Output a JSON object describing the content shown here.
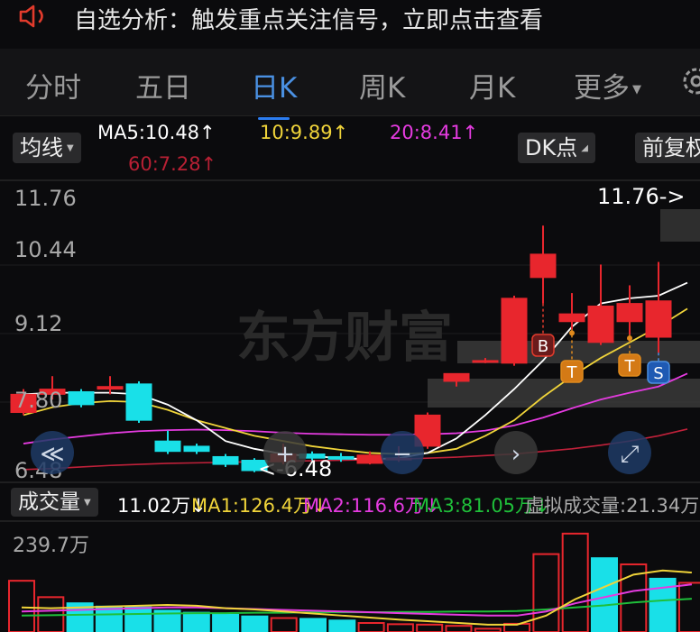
{
  "banner": {
    "text": "自选分析：触发重点关注信号，立即点击查看"
  },
  "tabs": [
    {
      "label": "分时",
      "active": false
    },
    {
      "label": "五日",
      "active": false
    },
    {
      "label": "日K",
      "active": true
    },
    {
      "label": "周K",
      "active": false
    },
    {
      "label": "月K",
      "active": false
    },
    {
      "label": "更多",
      "active": false
    }
  ],
  "ma_bar": {
    "indicator": "均线",
    "ma5": "MA5:10.48↑",
    "ma10": "10:9.89↑",
    "ma20": "20:8.41↑",
    "ma60": "60:7.28↑",
    "dk_button": "DK点",
    "adjust_button": "前复权"
  },
  "price_axis": {
    "labels": [
      "11.76",
      "10.44",
      "9.12",
      "7.80",
      "6.48"
    ]
  },
  "markers": {
    "high": "11.76->",
    "low": "<-6.48"
  },
  "signals": [
    "B",
    "T",
    "T",
    "S"
  ],
  "watermark": "东方财富",
  "volume_bar": {
    "indicator": "成交量",
    "volume": "11.02万↓",
    "ma1": "MA1:126.4万↓",
    "ma2": "MA2:116.6万↓",
    "ma3": "MA3:81.05万↓",
    "virtual": "虚拟成交量:21.34万",
    "axis_max": "239.7万"
  },
  "colors": {
    "up": "#e8262d",
    "down": "#19e0e8",
    "ma5": "#ffffff",
    "ma10": "#f0d43a",
    "ma20": "#e53be0",
    "ma60": "#c0213a",
    "accent": "#2b7cf0"
  },
  "chart_data": {
    "type": "candlestick",
    "ylim": [
      6.48,
      11.76
    ],
    "candles": [
      {
        "o": 7.6,
        "c": 7.95,
        "h": 8.05,
        "l": 7.55
      },
      {
        "o": 7.95,
        "c": 8.05,
        "h": 8.3,
        "l": 7.85
      },
      {
        "o": 8.0,
        "c": 7.75,
        "h": 8.05,
        "l": 7.7
      },
      {
        "o": 8.05,
        "c": 8.1,
        "h": 8.3,
        "l": 7.95
      },
      {
        "o": 8.15,
        "c": 7.45,
        "h": 8.2,
        "l": 7.4
      },
      {
        "o": 7.05,
        "c": 6.85,
        "h": 7.25,
        "l": 6.8
      },
      {
        "o": 6.95,
        "c": 6.85,
        "h": 7.0,
        "l": 6.8
      },
      {
        "o": 6.75,
        "c": 6.6,
        "h": 6.8,
        "l": 6.55
      },
      {
        "o": 6.68,
        "c": 6.48,
        "h": 6.72,
        "l": 6.45
      },
      {
        "o": 6.65,
        "c": 6.8,
        "h": 7.0,
        "l": 6.6
      },
      {
        "o": 6.8,
        "c": 6.72,
        "h": 6.85,
        "l": 6.68
      },
      {
        "o": 6.75,
        "c": 6.7,
        "h": 6.82,
        "l": 6.65
      },
      {
        "o": 6.62,
        "c": 6.78,
        "h": 6.85,
        "l": 6.6
      },
      {
        "o": 6.72,
        "c": 6.72,
        "h": 6.95,
        "l": 6.65
      },
      {
        "o": 6.95,
        "c": 7.55,
        "h": 7.6,
        "l": 6.9
      },
      {
        "o": 8.2,
        "c": 8.35,
        "h": 8.35,
        "l": 8.1
      },
      {
        "o": 8.6,
        "c": 8.6,
        "h": 8.65,
        "l": 8.55
      },
      {
        "o": 8.55,
        "c": 9.8,
        "h": 9.85,
        "l": 8.5
      },
      {
        "o": 10.2,
        "c": 10.65,
        "h": 11.2,
        "l": 9.7
      },
      {
        "o": 9.35,
        "c": 9.5,
        "h": 9.9,
        "l": 9.2
      },
      {
        "o": 8.95,
        "c": 9.65,
        "h": 10.45,
        "l": 8.9
      },
      {
        "o": 9.35,
        "c": 9.7,
        "h": 10.05,
        "l": 9.1
      },
      {
        "o": 9.05,
        "c": 9.75,
        "h": 10.5,
        "l": 8.75
      }
    ],
    "ma5": [
      7.95,
      7.98,
      7.98,
      7.98,
      7.95,
      7.75,
      7.45,
      7.05,
      6.9,
      6.8,
      6.76,
      6.72,
      6.7,
      6.72,
      6.82,
      7.1,
      7.55,
      8.05,
      8.6,
      9.25,
      9.7,
      9.8,
      9.85,
      10.1
    ],
    "ma10": [
      7.55,
      7.7,
      7.78,
      7.82,
      7.8,
      7.65,
      7.45,
      7.3,
      7.15,
      7.05,
      6.95,
      6.88,
      6.82,
      6.8,
      6.82,
      6.9,
      7.15,
      7.45,
      7.9,
      8.3,
      8.65,
      8.95,
      9.25,
      9.6
    ],
    "ma20": [
      7.0,
      7.08,
      7.14,
      7.2,
      7.24,
      7.26,
      7.27,
      7.26,
      7.24,
      7.21,
      7.19,
      7.18,
      7.17,
      7.17,
      7.18,
      7.2,
      7.25,
      7.35,
      7.5,
      7.68,
      7.85,
      7.98,
      8.1,
      8.35
    ],
    "ma60": [
      6.5,
      6.52,
      6.55,
      6.58,
      6.6,
      6.62,
      6.63,
      6.64,
      6.65,
      6.66,
      6.67,
      6.68,
      6.69,
      6.7,
      6.72,
      6.74,
      6.77,
      6.8,
      6.85,
      6.9,
      6.97,
      7.05,
      7.15,
      7.28
    ],
    "volume": {
      "ymax": 239.7,
      "bars": [
        125,
        85,
        70,
        62,
        60,
        52,
        47,
        42,
        38,
        34,
        32,
        28,
        22,
        19,
        18,
        15,
        8,
        20,
        190,
        240,
        180,
        165,
        130,
        120
      ],
      "up": [
        true,
        true,
        false,
        false,
        false,
        false,
        false,
        false,
        false,
        true,
        false,
        false,
        true,
        true,
        true,
        true,
        true,
        true,
        true,
        true,
        false,
        true,
        false,
        true
      ],
      "ma1": [
        60,
        58,
        60,
        62,
        64,
        66,
        64,
        58,
        55,
        50,
        45,
        40,
        35,
        30,
        26,
        22,
        18,
        18,
        40,
        80,
        110,
        140,
        150,
        145
      ],
      "ma2": [
        50,
        52,
        54,
        56,
        58,
        60,
        60,
        58,
        56,
        54,
        52,
        50,
        48,
        46,
        44,
        42,
        40,
        40,
        50,
        70,
        85,
        100,
        108,
        116
      ],
      "ma3": [
        40,
        41,
        42,
        43,
        44,
        45,
        46,
        46,
        47,
        47,
        48,
        48,
        48,
        49,
        49,
        50,
        50,
        51,
        55,
        60,
        65,
        72,
        77,
        81
      ]
    }
  }
}
